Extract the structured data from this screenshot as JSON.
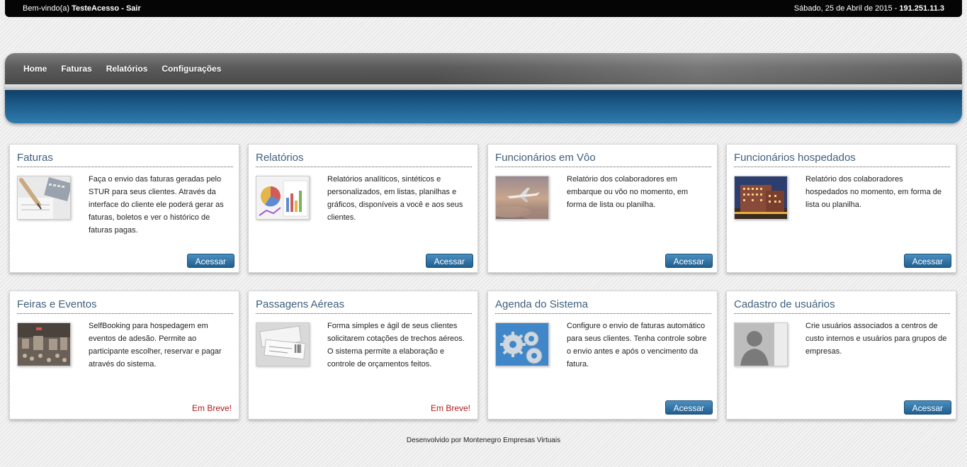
{
  "topbar": {
    "welcome": "Bem-vindo(a)",
    "user": "TesteAcesso",
    "separator": "-",
    "logout": "Sair",
    "date": "Sábado, 25 de Abril de 2015 -",
    "ip": "191.251.11.3"
  },
  "nav": {
    "items": [
      {
        "label": "Home"
      },
      {
        "label": "Faturas"
      },
      {
        "label": "Relatórios"
      },
      {
        "label": "Configurações"
      }
    ]
  },
  "cards": [
    {
      "title": "Faturas",
      "desc": "Faça o envio das faturas geradas pelo STUR para seus clientes. Através da interface do cliente ele poderá gerar as faturas, boletos e ver o histórico de faturas pagas.",
      "action": "Acessar",
      "icon": "invoice-photo-icon"
    },
    {
      "title": "Relatórios",
      "desc": "Relatórios analíticos, sintéticos e personalizados, em listas, planilhas e gráficos, disponíveis a você e aos seus clientes.",
      "action": "Acessar",
      "icon": "report-charts-icon"
    },
    {
      "title": "Funcionários em Vôo",
      "desc": "Relatório dos colaboradores em embarque ou vôo no momento, em forma de lista ou planilha.",
      "action": "Acessar",
      "icon": "airplane-photo-icon"
    },
    {
      "title": "Funcionários hospedados",
      "desc": "Relatório dos colaboradores hospedados no momento, em forma de lista ou planilha.",
      "action": "Acessar",
      "icon": "hotel-photo-icon"
    },
    {
      "title": "Feiras e Eventos",
      "desc": "SelfBooking para hospedagem em eventos de adesão. Permite ao participante escolher, reservar e pagar através do sistema.",
      "action": "Em Breve!",
      "icon": "event-photo-icon"
    },
    {
      "title": "Passagens Aéreas",
      "desc": "Forma simples e ágil de seus clientes solicitarem cotações de trechos aéreos. O sistema permite a elaboração e controle de orçamentos feitos.",
      "action": "Em Breve!",
      "icon": "tickets-photo-icon"
    },
    {
      "title": "Agenda do Sistema",
      "desc": "Configure o envio de faturas automático para seus clientes. Tenha controle sobre o envio antes e após o vencimento da fatura.",
      "action": "Acessar",
      "icon": "gears-icon"
    },
    {
      "title": "Cadastro de usuários",
      "desc": "Crie usuários associados a centros de custo internos e usuários para grupos de empresas.",
      "action": "Acessar",
      "icon": "user-silhouette-icon"
    }
  ],
  "footer": "Desenvolvido por Montenegro Empresas Virtuais",
  "colors": {
    "accent": "#2f6f9f",
    "soon": "#b11a1a",
    "title": "#3f5f7e"
  }
}
